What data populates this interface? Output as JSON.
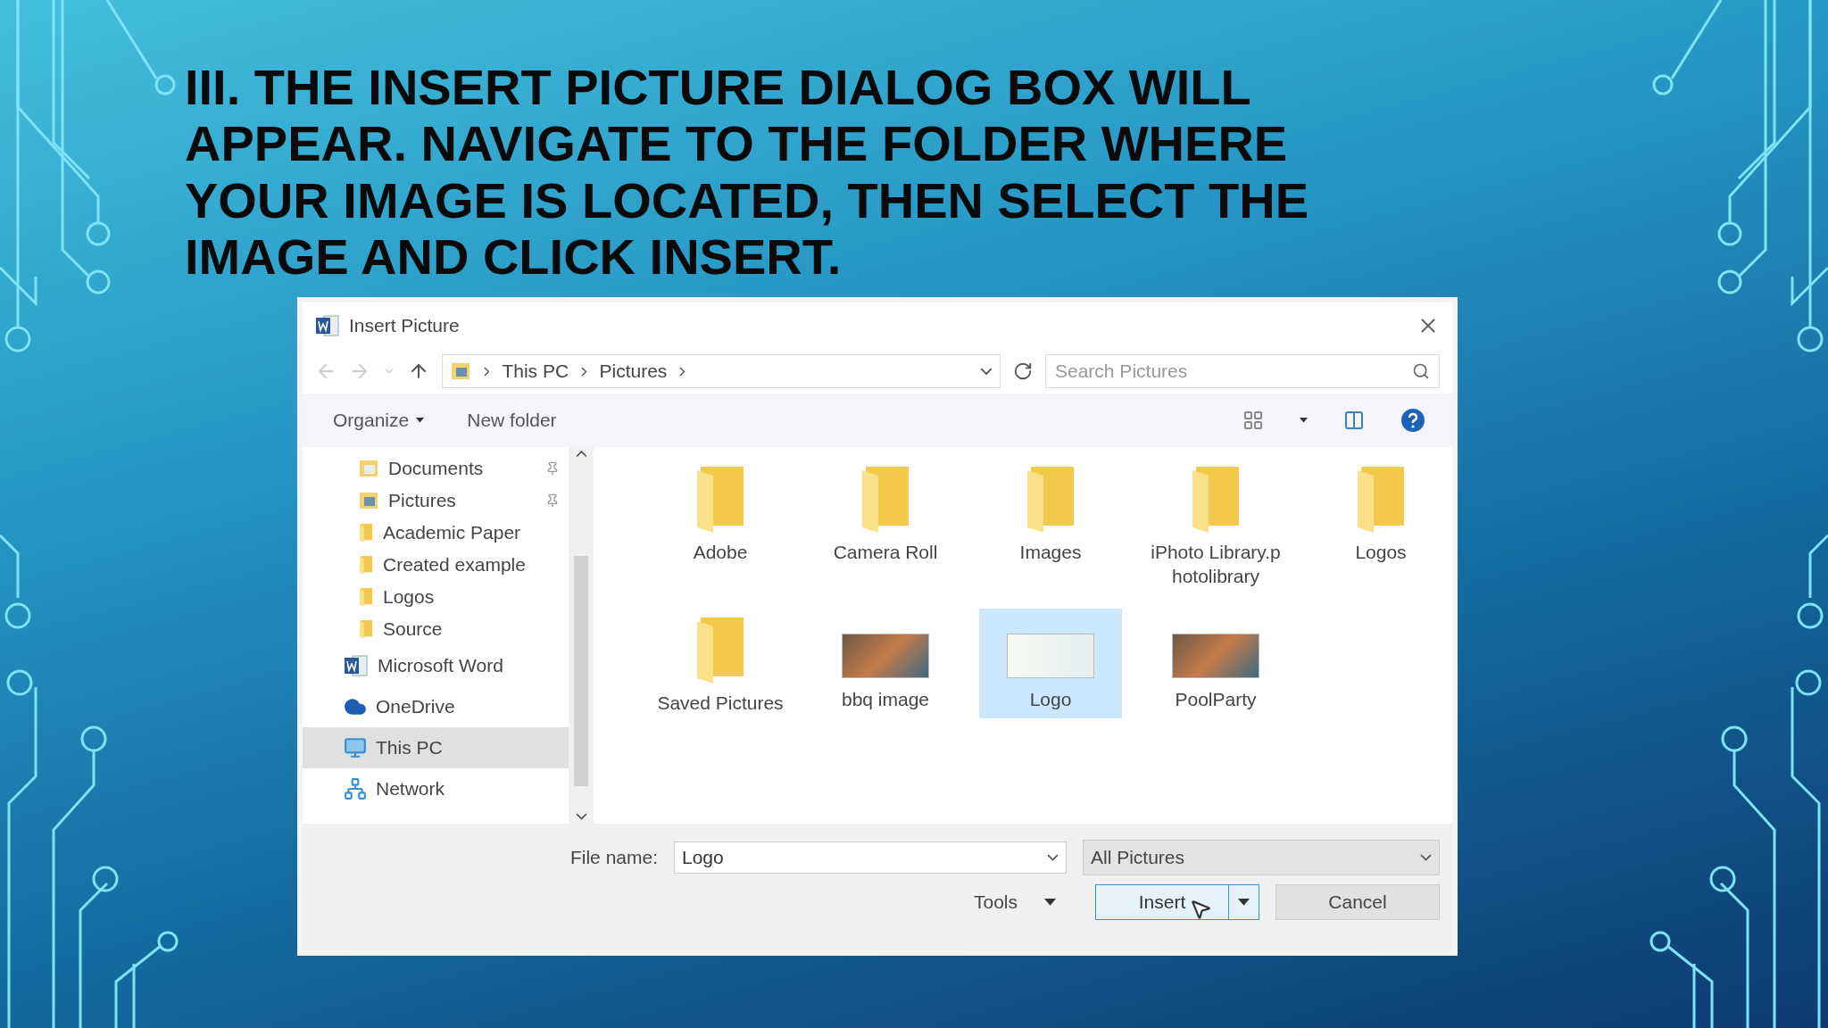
{
  "slide": {
    "title": "III. THE INSERT PICTURE DIALOG BOX WILL APPEAR. NAVIGATE TO THE FOLDER WHERE YOUR IMAGE IS LOCATED, THEN SELECT THE IMAGE AND CLICK INSERT."
  },
  "dialog": {
    "title": "Insert Picture",
    "address": [
      "This PC",
      "Pictures"
    ],
    "search": {
      "placeholder": "Search Pictures"
    },
    "toolbar": {
      "organize": "Organize",
      "new_folder": "New folder"
    },
    "nav": [
      {
        "label": "Documents",
        "kind": "documents",
        "pinned": true,
        "selected": false
      },
      {
        "label": "Pictures",
        "kind": "pictures",
        "pinned": true,
        "selected": false
      },
      {
        "label": "Academic Paper",
        "kind": "folder",
        "pinned": false,
        "selected": false
      },
      {
        "label": "Created example",
        "kind": "folder",
        "pinned": false,
        "selected": false
      },
      {
        "label": "Logos",
        "kind": "folder",
        "pinned": false,
        "selected": false
      },
      {
        "label": "Source",
        "kind": "folder",
        "pinned": false,
        "selected": false
      },
      {
        "label": "Microsoft Word",
        "kind": "word",
        "pinned": false,
        "selected": false
      },
      {
        "label": "OneDrive",
        "kind": "cloud",
        "pinned": false,
        "selected": false
      },
      {
        "label": "This PC",
        "kind": "computer",
        "pinned": false,
        "selected": true
      },
      {
        "label": "Network",
        "kind": "network",
        "pinned": false,
        "selected": false
      }
    ],
    "items": [
      {
        "label": "Adobe",
        "kind": "folder",
        "selected": false
      },
      {
        "label": "Camera Roll",
        "kind": "folder",
        "selected": false
      },
      {
        "label": "Images",
        "kind": "folder",
        "selected": false
      },
      {
        "label": "iPhoto Library.photolibrary",
        "kind": "folder",
        "selected": false
      },
      {
        "label": "Logos",
        "kind": "folder",
        "selected": false
      },
      {
        "label": "Saved Pictures",
        "kind": "folder",
        "selected": false
      },
      {
        "label": "bbq image",
        "kind": "photo",
        "selected": false
      },
      {
        "label": "Logo",
        "kind": "logo",
        "selected": true
      },
      {
        "label": "PoolParty",
        "kind": "photo",
        "selected": false
      }
    ],
    "file_name": {
      "label": "File name:",
      "value": "Logo"
    },
    "file_type": "All Pictures",
    "buttons": {
      "tools": "Tools",
      "insert": "Insert",
      "cancel": "Cancel"
    }
  }
}
